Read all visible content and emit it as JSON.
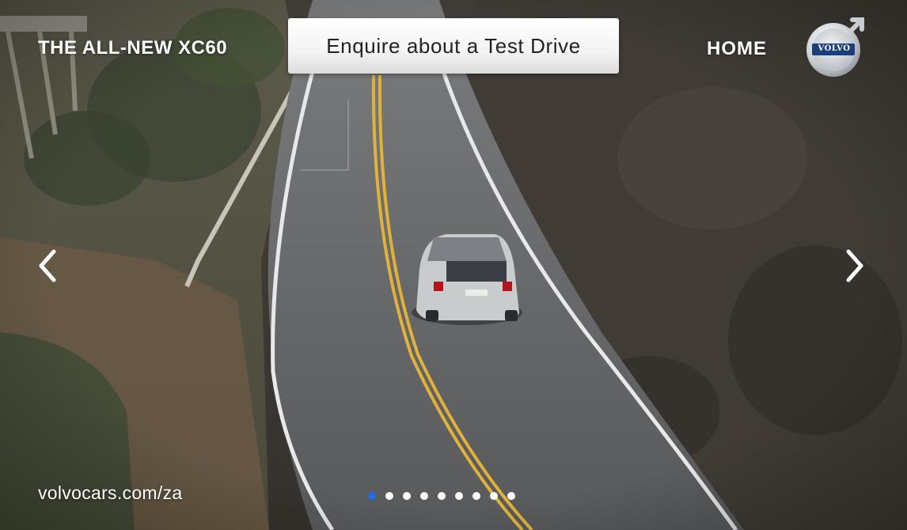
{
  "header": {
    "model_title": "THE ALL-NEW XC60",
    "cta_label": "Enquire about a Test Drive",
    "home_label": "HOME",
    "logo_text": "VOLVO"
  },
  "carousel": {
    "prev_icon": "chevron-left-icon",
    "next_icon": "chevron-right-icon",
    "slide_count": 9,
    "active_index": 0
  },
  "footer": {
    "site_url": "volvocars.com/za"
  },
  "colors": {
    "active_dot": "#1e6ee6",
    "inactive_dot": "#ffffff",
    "text": "#ffffff"
  }
}
